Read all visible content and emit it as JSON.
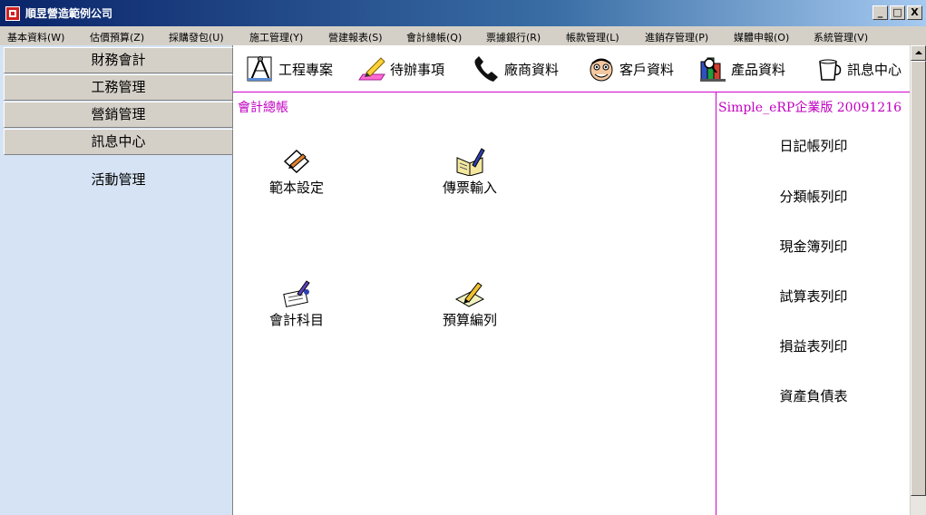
{
  "window": {
    "title": "順昱營造範例公司",
    "minimize": "_",
    "maximize": "□",
    "close": "X"
  },
  "menu": [
    "基本資料(W)",
    "估價預算(Z)",
    "採購發包(U)",
    "施工管理(Y)",
    "營建報表(S)",
    "會計總帳(Q)",
    "票據銀行(R)",
    "帳款管理(L)",
    "進銷存管理(P)",
    "媒體申報(O)",
    "系統管理(V)"
  ],
  "sidebar": {
    "buttons": [
      "財務會計",
      "工務管理",
      "營銷管理",
      "訊息中心"
    ],
    "links": [
      "活動管理"
    ]
  },
  "toolbar": [
    {
      "label": "工程專案",
      "icon": "compass-ruler-icon"
    },
    {
      "label": "待辦事項",
      "icon": "pencil-eraser-icon"
    },
    {
      "label": "廠商資料",
      "icon": "telephone-icon"
    },
    {
      "label": "客戶資料",
      "icon": "face-icon"
    },
    {
      "label": "產品資料",
      "icon": "books-icon"
    },
    {
      "label": "訊息中心",
      "icon": "coffee-cup-icon"
    }
  ],
  "main": {
    "section_title": "會計總帳",
    "version": "Simple_eRP企業版 20091216",
    "functions": [
      {
        "label": "範本設定",
        "icon": "template-icon"
      },
      {
        "label": "傳票輸入",
        "icon": "voucher-book-icon"
      },
      {
        "label": "會計科目",
        "icon": "accounting-pen-icon"
      },
      {
        "label": "預算編列",
        "icon": "budget-pencil-icon"
      }
    ],
    "reports": [
      "日記帳列印",
      "分類帳列印",
      "現金簿列印",
      "試算表列印",
      "損益表列印",
      "資產負債表"
    ]
  },
  "colors": {
    "accent": "#c000c0",
    "sidebar_bg": "#d5e3f5",
    "titlebar": "#0a246a"
  }
}
